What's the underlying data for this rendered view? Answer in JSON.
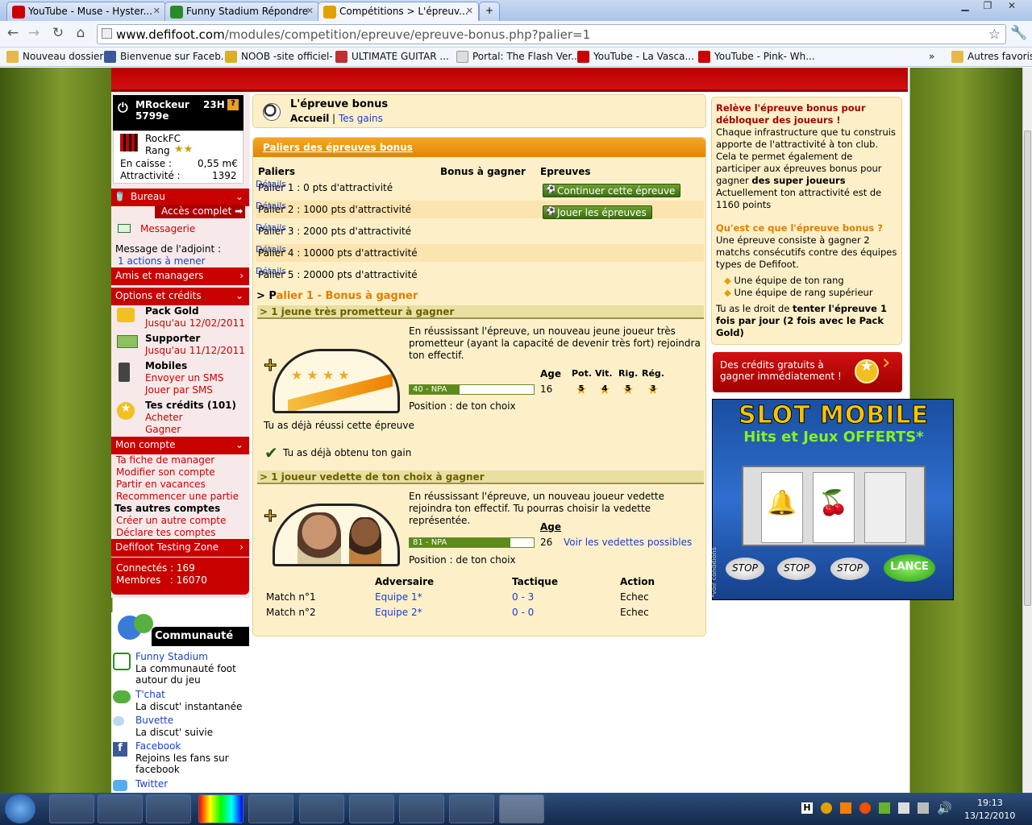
{
  "browser": {
    "tabs": [
      {
        "title": "YouTube - Muse - Hyster...",
        "color": "#cc0000"
      },
      {
        "title": "Funny Stadium Répondre",
        "color": "#2a8a2a"
      },
      {
        "title": "Compétitions > L'épreuv...",
        "color": "#e0a000"
      }
    ],
    "url_host": "www.defifoot.com",
    "url_path": "/modules/competition/epreuve/epreuve-bonus.php?palier=1",
    "bookmarks": [
      {
        "label": "Nouveau dossier",
        "icon": "folder-icon",
        "color": "#e6b84a"
      },
      {
        "label": "Bienvenue sur Faceb...",
        "icon": "facebook-icon",
        "color": "#3b5998"
      },
      {
        "label": "NOOB -site officiel-",
        "icon": "shield-icon",
        "color": "#d9b020"
      },
      {
        "label": "ULTIMATE GUITAR ...",
        "icon": "guitar-icon",
        "color": "#c03030"
      },
      {
        "label": "Portal: The Flash Ver...",
        "icon": "page-icon",
        "color": "#dddddd"
      },
      {
        "label": "YouTube - La Vasca...",
        "icon": "youtube-icon",
        "color": "#cc0000"
      },
      {
        "label": "YouTube - Pink- Wh...",
        "icon": "youtube-icon",
        "color": "#cc0000"
      }
    ],
    "other_bookmarks": "Autres favoris"
  },
  "left": {
    "user": "MRockeur",
    "hours": "23H",
    "money": "5799e",
    "club": "RockFC",
    "rank_label": "Rang",
    "caisse_label": "En caisse :",
    "caisse": "0,55 m€",
    "attract_label": "Attractivité :",
    "attract": "1392",
    "bureau": "Bureau",
    "acces": "Accès complet",
    "messagerie": "Messagerie",
    "adjoint": "Message de l'adjoint :",
    "actions": "1 actions à mener",
    "amis": "Amis et managers",
    "options": "Options et crédits",
    "pack": "Pack Gold",
    "pack_date": "Jusqu'au 12/02/2011",
    "supporter": "Supporter",
    "supporter_date": "Jusqu'au 11/12/2011",
    "mobiles": "Mobiles",
    "sms": "Envoyer un SMS",
    "jouer_sms": "Jouer par SMS",
    "credits": "Tes crédits (101)",
    "acheter": "Acheter",
    "gagner": "Gagner",
    "compte": "Mon compte",
    "compte_links": [
      "Ta fiche de manager",
      "Modifier son compte",
      "Partir en vacances",
      "Recommencer une partie"
    ],
    "autres": "Tes autres comptes",
    "autres_links": [
      "Créer un autre compte",
      "Déclare tes comptes"
    ],
    "testing": "Defifoot Testing Zone",
    "connectes": "Connectés : 169",
    "membres": "Membres   : 16070",
    "communaute": "Communauté",
    "comm_items": [
      {
        "name": "Funny Stadium",
        "desc": "La communauté foot autour du jeu"
      },
      {
        "name": "T'chat",
        "desc": "La discut' instantanée"
      },
      {
        "name": "Buvette",
        "desc": "La discut' suivie"
      },
      {
        "name": "Facebook",
        "desc": "Rejoins les fans sur facebook"
      },
      {
        "name": "Twitter",
        "desc": ""
      }
    ]
  },
  "center": {
    "title": "L'épreuve bonus",
    "accueil": "Accueil",
    "sep": "|",
    "gains": "Tes gains",
    "paliers_title": "Paliers des épreuves bonus",
    "col_paliers": "Paliers",
    "col_bonus": "Bonus à gagner",
    "col_epreuves": "Epreuves",
    "rows": [
      {
        "palier": "Palier 1 : 0 pts d'attractivité",
        "details": "Détails",
        "action": "Continuer cette épreuve"
      },
      {
        "palier": "Palier 2 : 1000 pts d'attractivité",
        "details": "Détails",
        "action": "Jouer les épreuves"
      },
      {
        "palier": "Palier 3 : 2000 pts d'attractivité",
        "details": "Détails",
        "action": ""
      },
      {
        "palier": "Palier 4 : 10000 pts d'attractivité",
        "details": "Détails",
        "action": ""
      },
      {
        "palier": "Palier 5 : 20000 pts d'attractivité",
        "details": "Détails",
        "action": ""
      }
    ],
    "palier_heading_prefix": "> P",
    "palier_heading_rest": "alier 1 - Bonus à gagner",
    "bonus1_title": "> 1 jeune très prometteur à gagner",
    "bonus1_text": "En réussissant l'épreuve, un nouveau jeune joueur très prometteur (ayant la capacité de devenir très fort) rejoindra ton effectif.",
    "age_label": "Age",
    "pot": "Pot.",
    "vit": "Vit.",
    "rig": "Rig.",
    "reg": "Rég.",
    "bonus1_bar": "40 - NPA",
    "bonus1_bar_value": 0.4,
    "bonus1_age": "16",
    "bonus1_stars": [
      "5",
      "4",
      "5",
      "3"
    ],
    "position": "Position : de ton choix",
    "reussi": "Tu as déjà réussi cette épreuve",
    "obtenu": "Tu as déjà obtenu ton gain",
    "bonus2_title": "> 1 joueur vedette de ton choix à gagner",
    "bonus2_text": "En réussissant l'épreuve, un nouveau joueur vedette rejoindra ton effectif. Tu pourras choisir la vedette représentée.",
    "bonus2_bar": "81 - NPA",
    "bonus2_bar_value": 0.81,
    "bonus2_age": "26",
    "vedettes": "Voir les vedettes possibles",
    "col_adv": "Adversaire",
    "col_tac": "Tactique",
    "col_act": "Action",
    "matches": [
      {
        "name": "Match n°1",
        "adv": "Equipe 1*",
        "tac": "0 - 3",
        "act": "Echec"
      },
      {
        "name": "Match n°2",
        "adv": "Equipe 2*",
        "tac": "0 - 0",
        "act": "Echec"
      }
    ]
  },
  "right": {
    "h1": "Relève l'épreuve bonus pour débloquer des joueurs !",
    "p1a": "Chaque infrastructure que tu construis apporte de l'attractivité à ton club. Cela te permet également de participer aux épreuves bonus pour gagner ",
    "p1b": "des super joueurs",
    "p2": "Actuellement ton attractivité est de 1160 points",
    "h2": "Qu'est ce que l'épreuve bonus ?",
    "p3": "Une épreuve consiste à gagner 2 matchs consécutifs contre des équipes types de Defifoot.",
    "li1": "Une équipe de ton rang",
    "li2": "Une équipe de rang supérieur",
    "p4a": "Tu as le droit de ",
    "p4b": "tenter l'épreuve 1 fois par jour (2 fois avec le Pack Gold)",
    "credits_ad": "Des crédits gratuits à gagner immédiatement !",
    "slot_title": "SLOT MOBILE",
    "slot_sub": "Hits et Jeux OFFERTS*",
    "slot_buttons": [
      "STOP",
      "STOP",
      "STOP",
      "LANCE"
    ],
    "slot_note": "*voir conditions"
  },
  "taskbar": {
    "time": "19:13",
    "date": "13/12/2010"
  }
}
